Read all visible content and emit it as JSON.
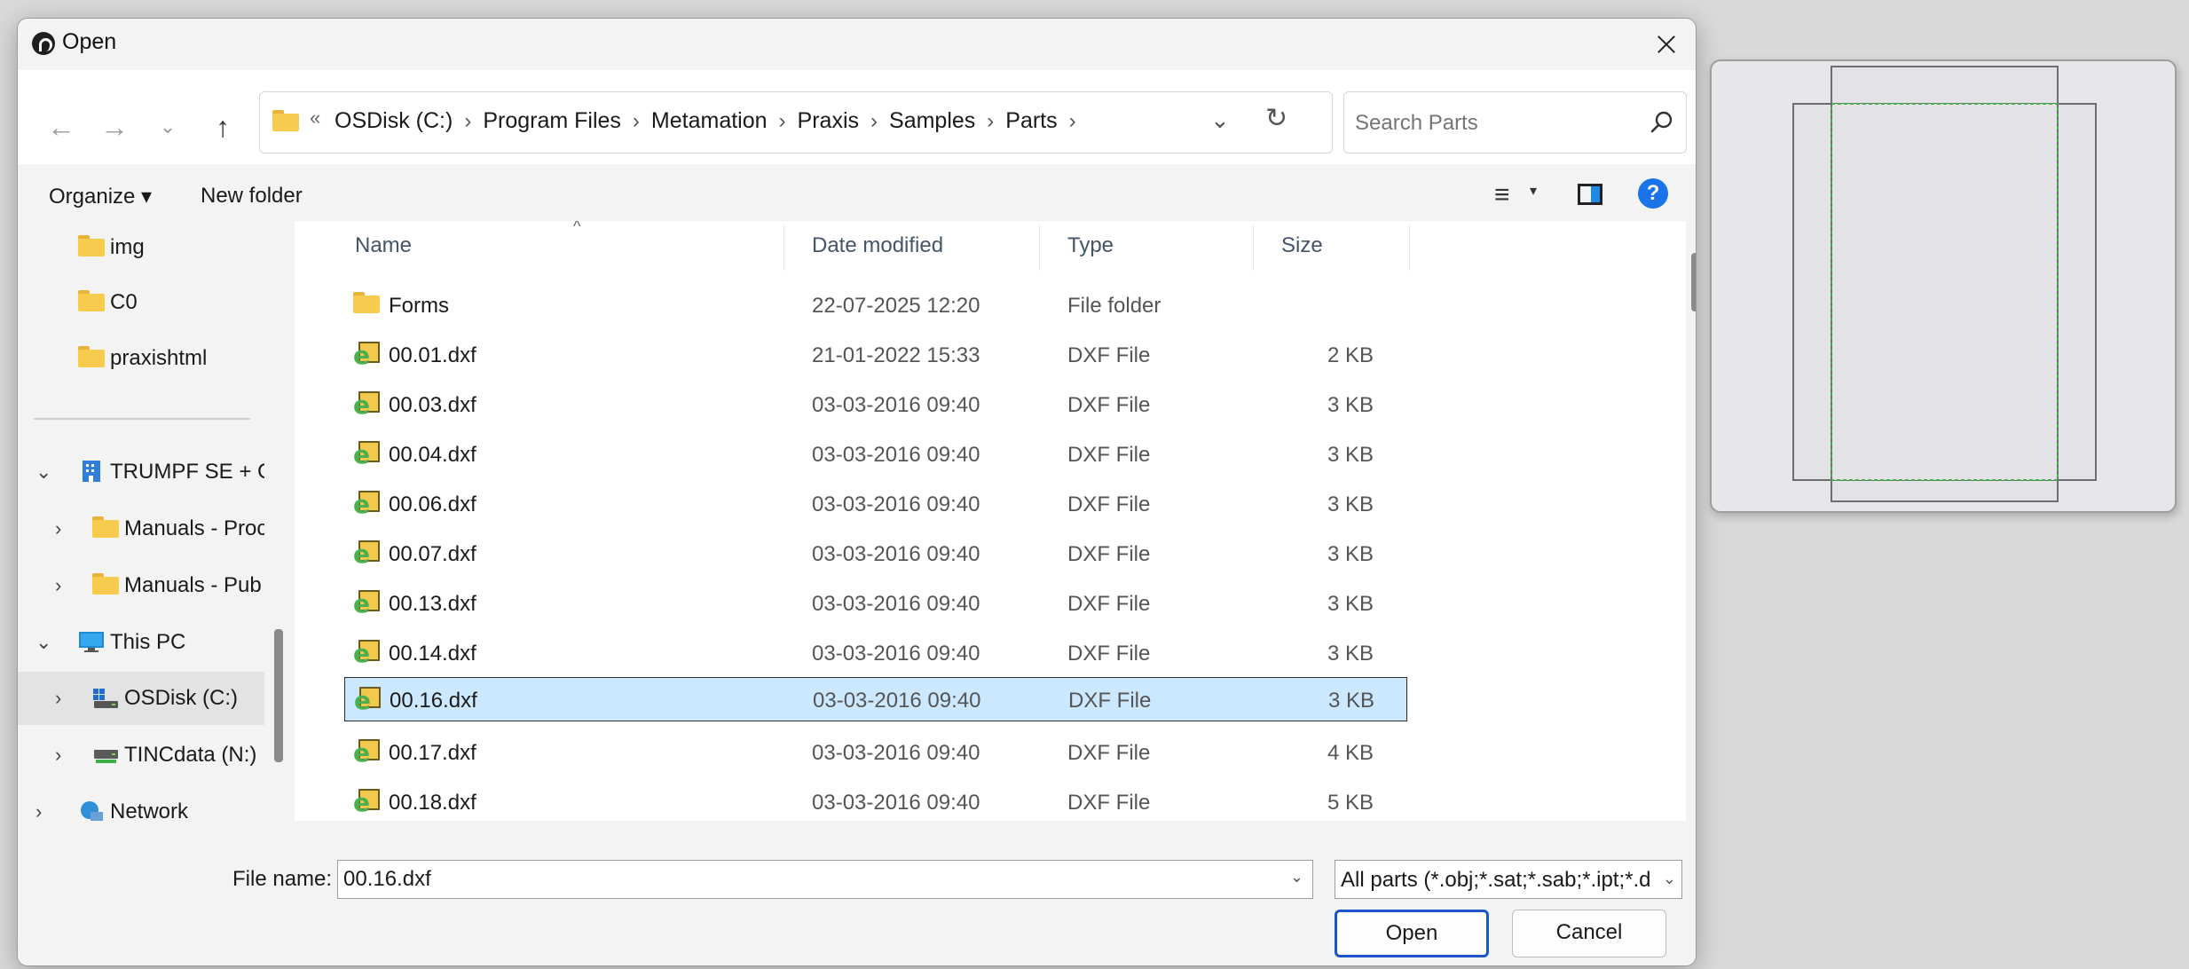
{
  "dialog": {
    "title": "Open"
  },
  "navigation": {
    "breadcrumb_overflow": "«",
    "breadcrumbs": [
      "OSDisk (C:)",
      "Program Files",
      "Metamation",
      "Praxis",
      "Samples",
      "Parts"
    ],
    "search_placeholder": "Search Parts"
  },
  "toolbar": {
    "organize_label": "Organize ▾",
    "new_folder_label": "New folder",
    "help_label": "?"
  },
  "sidebar": {
    "items": [
      {
        "label": "img",
        "icon": "folder-icon",
        "expand": ""
      },
      {
        "label": "C0",
        "icon": "folder-icon",
        "expand": ""
      },
      {
        "label": "praxishtml",
        "icon": "folder-icon",
        "expand": ""
      },
      {
        "label": "TRUMPF SE + Co",
        "icon": "building-icon",
        "expand": "⌄"
      },
      {
        "label": "Manuals - Proc",
        "icon": "folder-icon",
        "expand": "›"
      },
      {
        "label": "Manuals - Pub",
        "icon": "folder-icon",
        "expand": "›"
      },
      {
        "label": "This PC",
        "icon": "monitor-icon",
        "expand": "⌄"
      },
      {
        "label": "OSDisk (C:)",
        "icon": "drive-icon",
        "expand": "›"
      },
      {
        "label": "TINCdata (N:)",
        "icon": "network-drive-icon",
        "expand": "›"
      },
      {
        "label": "Network",
        "icon": "network-icon",
        "expand": "›"
      }
    ]
  },
  "filelist": {
    "columns": [
      "Name",
      "Date modified",
      "Type",
      "Size"
    ],
    "rows": [
      {
        "name": "Forms",
        "date": "22-07-2025 12:20",
        "type": "File folder",
        "size": "",
        "icon": "folder-icon"
      },
      {
        "name": "00.01.dxf",
        "date": "21-01-2022 15:33",
        "type": "DXF File",
        "size": "2 KB",
        "icon": "dxf-icon"
      },
      {
        "name": "00.03.dxf",
        "date": "03-03-2016 09:40",
        "type": "DXF File",
        "size": "3 KB",
        "icon": "dxf-icon"
      },
      {
        "name": "00.04.dxf",
        "date": "03-03-2016 09:40",
        "type": "DXF File",
        "size": "3 KB",
        "icon": "dxf-icon"
      },
      {
        "name": "00.06.dxf",
        "date": "03-03-2016 09:40",
        "type": "DXF File",
        "size": "3 KB",
        "icon": "dxf-icon"
      },
      {
        "name": "00.07.dxf",
        "date": "03-03-2016 09:40",
        "type": "DXF File",
        "size": "3 KB",
        "icon": "dxf-icon"
      },
      {
        "name": "00.13.dxf",
        "date": "03-03-2016 09:40",
        "type": "DXF File",
        "size": "3 KB",
        "icon": "dxf-icon"
      },
      {
        "name": "00.14.dxf",
        "date": "03-03-2016 09:40",
        "type": "DXF File",
        "size": "3 KB",
        "icon": "dxf-icon"
      },
      {
        "name": "00.16.dxf",
        "date": "03-03-2016 09:40",
        "type": "DXF File",
        "size": "3 KB",
        "icon": "dxf-icon",
        "selected": true
      },
      {
        "name": "00.17.dxf",
        "date": "03-03-2016 09:40",
        "type": "DXF File",
        "size": "4 KB",
        "icon": "dxf-icon"
      },
      {
        "name": "00.18.dxf",
        "date": "03-03-2016 09:40",
        "type": "DXF File",
        "size": "5 KB",
        "icon": "dxf-icon"
      }
    ]
  },
  "footer": {
    "file_name_label": "File name:",
    "file_name_value": "00.16.dxf",
    "filter_value": "All parts (*.obj;*.sat;*.sab;*.ipt;*.d",
    "open_label": "Open",
    "cancel_label": "Cancel"
  },
  "colors": {
    "accent": "#1a73e8",
    "selection": "#cce8ff",
    "preview_dashed": "#3cb043"
  }
}
